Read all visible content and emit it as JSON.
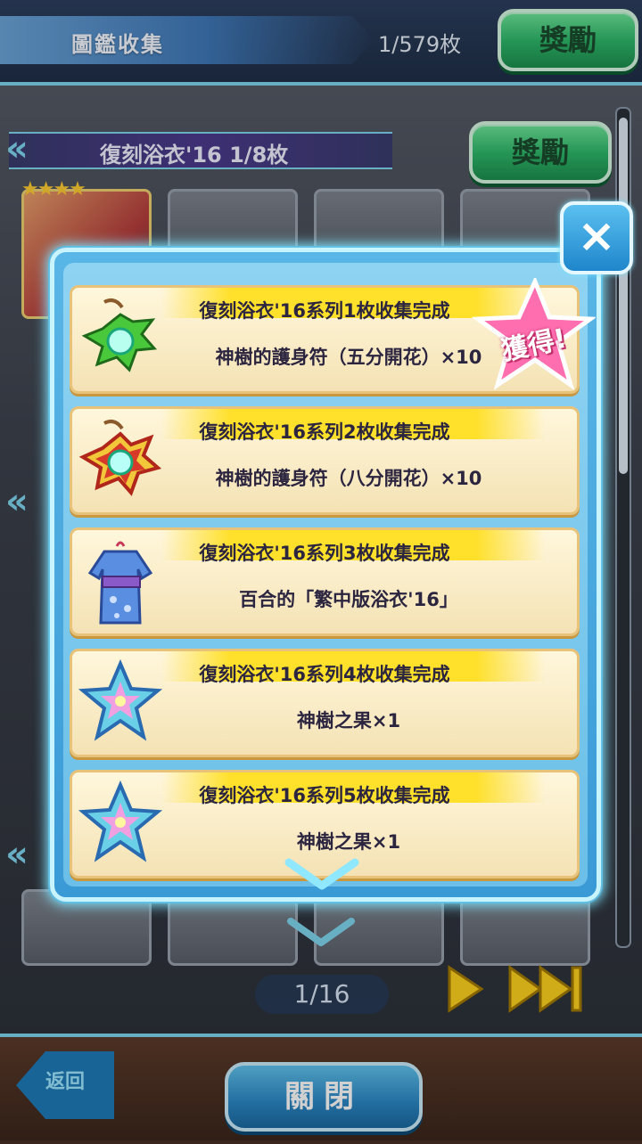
{
  "header": {
    "title": "圖鑑收集",
    "count": "1/579枚",
    "reward_label": "獎勵"
  },
  "series": {
    "title": "復刻浴衣'16  1/8枚",
    "reward_label": "獎勵",
    "stars": "★★★★"
  },
  "modal": {
    "obtained_badge": "獲得!",
    "close_icon": "×",
    "rows": [
      {
        "title": "復刻浴衣'16系列1枚收集完成",
        "reward": "神樹的護身符（五分開花）×10",
        "icon": "charm-green-icon"
      },
      {
        "title": "復刻浴衣'16系列2枚收集完成",
        "reward": "神樹的護身符（八分開花）×10",
        "icon": "charm-red-icon"
      },
      {
        "title": "復刻浴衣'16系列3枚收集完成",
        "reward": "百合的「繁中版浴衣'16」",
        "icon": "yukata-icon"
      },
      {
        "title": "復刻浴衣'16系列4枚收集完成",
        "reward": "神樹之果×1",
        "icon": "star-fruit-icon"
      },
      {
        "title": "復刻浴衣'16系列5枚收集完成",
        "reward": "神樹之果×1",
        "icon": "star-fruit-icon"
      }
    ]
  },
  "bottom": {
    "page_indicator": "1/16",
    "back_label": "返回",
    "close_label": "關閉"
  },
  "colors": {
    "accent": "#7fd6f0",
    "row_head": "#ffe02a",
    "button_green": "#2fb86a",
    "button_blue": "#2b86c4"
  }
}
